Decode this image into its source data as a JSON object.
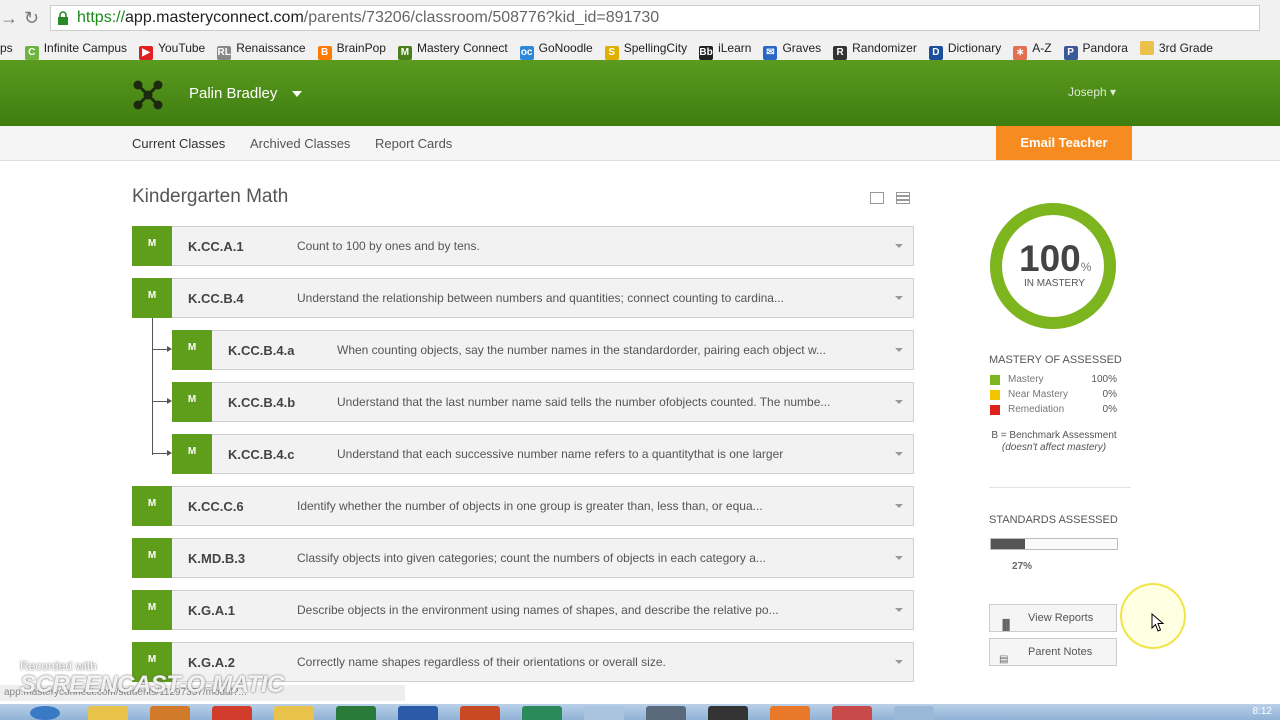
{
  "browser": {
    "url_secure": "https://",
    "url_domain": "app.masteryconnect.com",
    "url_path": "/parents/73206/classroom/508776?kid_id=891730",
    "bookmarks": [
      {
        "label": "ps",
        "color": "#f1f1f1",
        "glyph": ""
      },
      {
        "label": "Infinite Campus",
        "color": "#6fb43f",
        "glyph": "C"
      },
      {
        "label": "YouTube",
        "color": "#e02020",
        "glyph": "▶"
      },
      {
        "label": "Renaissance",
        "color": "#888888",
        "glyph": "RL"
      },
      {
        "label": "BrainPop",
        "color": "#ff7a00",
        "glyph": "B"
      },
      {
        "label": "Mastery Connect",
        "color": "#4a7f1a",
        "glyph": "M"
      },
      {
        "label": "GoNoodle",
        "color": "#2e88d8",
        "glyph": "oc"
      },
      {
        "label": "SpellingCity",
        "color": "#e0b000",
        "glyph": "S"
      },
      {
        "label": "iLearn",
        "color": "#222222",
        "glyph": "Bb"
      },
      {
        "label": "Graves",
        "color": "#2a66c4",
        "glyph": "✉"
      },
      {
        "label": "Randomizer",
        "color": "#333333",
        "glyph": "R"
      },
      {
        "label": "Dictionary",
        "color": "#1c4f9c",
        "glyph": "D"
      },
      {
        "label": "A-Z",
        "color": "#e07050",
        "glyph": "∗"
      },
      {
        "label": "Pandora",
        "color": "#3b5998",
        "glyph": "P"
      },
      {
        "label": "3rd Grade",
        "color": "#e8c24a",
        "glyph": ""
      }
    ]
  },
  "header": {
    "student_name": "Palin Bradley",
    "user_name": "Joseph"
  },
  "subnav": {
    "tabs": [
      "Current Classes",
      "Archived Classes",
      "Report Cards"
    ],
    "email_button": "Email Teacher"
  },
  "main": {
    "class_title": "Kindergarten Math",
    "standards": [
      {
        "badge": "M",
        "code": "K.CC.A.1",
        "desc": "Count to 100 by ones and by tens.",
        "level": 0
      },
      {
        "badge": "M",
        "code": "K.CC.B.4",
        "desc": "Understand the relationship between numbers and quantities; connect counting to cardina...",
        "level": 0
      },
      {
        "badge": "M",
        "code": "K.CC.B.4.a",
        "desc": "When counting objects, say the number names in the standardorder, pairing each object w...",
        "level": 1
      },
      {
        "badge": "M",
        "code": "K.CC.B.4.b",
        "desc": "Understand that the last number name said tells the number ofobjects counted. The numbe...",
        "level": 1
      },
      {
        "badge": "M",
        "code": "K.CC.B.4.c",
        "desc": "Understand that each successive number name refers to a quantitythat is one larger",
        "level": 1
      },
      {
        "badge": "M",
        "code": "K.CC.C.6",
        "desc": "Identify whether the number of objects in one group is greater than, less than, or equa...",
        "level": 0
      },
      {
        "badge": "M",
        "code": "K.MD.B.3",
        "desc": "Classify objects into given categories; count the numbers of objects in each category a...",
        "level": 0
      },
      {
        "badge": "M",
        "code": "K.G.A.1",
        "desc": "Describe objects in the environment using names of shapes, and describe the relative po...",
        "level": 0
      },
      {
        "badge": "M",
        "code": "K.G.A.2",
        "desc": "Correctly name shapes regardless of their orientations or overall size.",
        "level": 0
      }
    ]
  },
  "sidebar": {
    "mastery_value": "100",
    "mastery_pct_sign": "%",
    "mastery_label": "IN MASTERY",
    "mastery_fraction": 1.0,
    "assessed_heading": "MASTERY OF ASSESSED",
    "legend": [
      {
        "name": "Mastery",
        "value": "100%",
        "color": "#7cb51d"
      },
      {
        "name": "Near Mastery",
        "value": "0%",
        "color": "#f2c500"
      },
      {
        "name": "Remediation",
        "value": "0%",
        "color": "#e0201a"
      }
    ],
    "benchmark_note": "B = Benchmark Assessment",
    "benchmark_sub": "(doesn't affect mastery)",
    "standards_heading": "STANDARDS ASSESSED",
    "standards_value": "27%",
    "standards_fraction": 0.27,
    "buttons": [
      {
        "label": "View Reports",
        "icon": "bar-chart-icon"
      },
      {
        "label": "Parent Notes",
        "icon": "notes-icon"
      }
    ]
  },
  "overlay": {
    "watermark_small": "Recorded with",
    "watermark_big": "SCREENCAST-O-MATIC",
    "status_url": "app.masteryconnect.com/students/11297357/modal?...",
    "clock": "8:12"
  },
  "colors": {
    "header_green": "#4a8a16",
    "mastery_green": "#5f9e1a",
    "accent_orange": "#f68b1f"
  }
}
